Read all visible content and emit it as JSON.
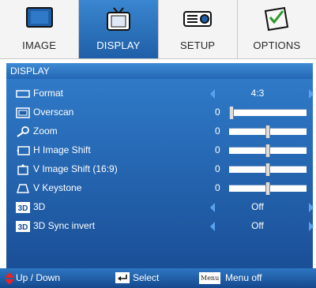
{
  "tabs": [
    {
      "label": "IMAGE",
      "active": false
    },
    {
      "label": "DISPLAY",
      "active": true
    },
    {
      "label": "SETUP",
      "active": false
    },
    {
      "label": "OPTIONS",
      "active": false
    }
  ],
  "section": {
    "title": "DISPLAY"
  },
  "rows": [
    {
      "label": "Format",
      "value": "4:3",
      "icon": "aspect-icon"
    },
    {
      "label": "Overscan",
      "value": "0",
      "icon": "overscan-icon",
      "slider": 0.0
    },
    {
      "label": "Zoom",
      "value": "0",
      "icon": "zoom-icon",
      "slider": 0.5
    },
    {
      "label": "H Image Shift",
      "value": "0",
      "icon": "h-shift-icon",
      "slider": 0.5
    },
    {
      "label": "V Image Shift (16:9)",
      "value": "0",
      "icon": "v-shift-icon",
      "slider": 0.5
    },
    {
      "label": "V Keystone",
      "value": "0",
      "icon": "keystone-icon",
      "slider": 0.5
    },
    {
      "label": "3D",
      "value": "Off",
      "icon": "3d-icon"
    },
    {
      "label": "3D Sync invert",
      "value": "Off",
      "icon": "3d-sync-icon"
    }
  ],
  "footer": {
    "up_down": "Up / Down",
    "select": "Select",
    "menu_key": "Menu",
    "menu_off": "Menu off"
  },
  "colors": {
    "accent": "#2467b5",
    "list_bg": "#1a4f97",
    "arrow": "#5aa2ee"
  }
}
